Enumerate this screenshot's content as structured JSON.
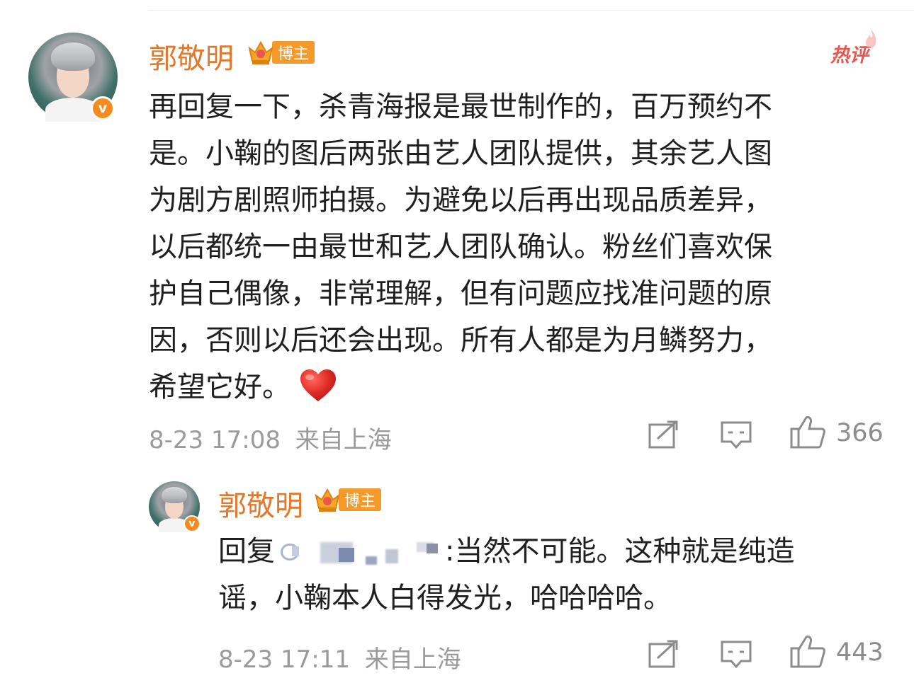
{
  "hot_label": "热评",
  "comments": [
    {
      "author": "郭敬明",
      "badge_label": "博主",
      "verified_icon": "v-badge",
      "text_lines": [
        "再回复一下，杀青海报是最世制作的，百万预约不",
        "是。小鞠的图后两张由艺人团队提供，其余艺人图",
        "为剧方剧照师拍摄。为避免以后再出现品质差异，",
        "以后都统一由最世和艺人团队确认。粉丝们喜欢保",
        "护自己偶像，非常理解，但有问题应找准问题的原",
        "因，否则以后还会出现。所有人都是为月鳞努力，",
        "希望它好。"
      ],
      "timestamp": "8-23 17:08",
      "location": "来自上海",
      "like_count": "366"
    },
    {
      "author": "郭敬明",
      "badge_label": "博主",
      "verified_icon": "v-badge",
      "reply_prefix": "回复",
      "reply_rest_line1": ":当然不可能。这种就是纯造",
      "reply_line2": "谣，小鞠本人白得发光，哈哈哈哈。",
      "timestamp": "8-23 17:11",
      "location": "来自上海",
      "like_count": "443"
    }
  ],
  "colors": {
    "author_name": "#e1782c",
    "badge_bg": "#f49a2a",
    "verified_bg": "#f58a1f",
    "hot_tag": "#e8564f",
    "heart": "#e02b26",
    "meta_text": "#9a9a9a",
    "body_text": "#1f1f1f"
  },
  "icons": [
    "share-icon",
    "comment-icon",
    "like-icon",
    "heart-emoji-icon",
    "crown-icon",
    "flame-icon"
  ]
}
